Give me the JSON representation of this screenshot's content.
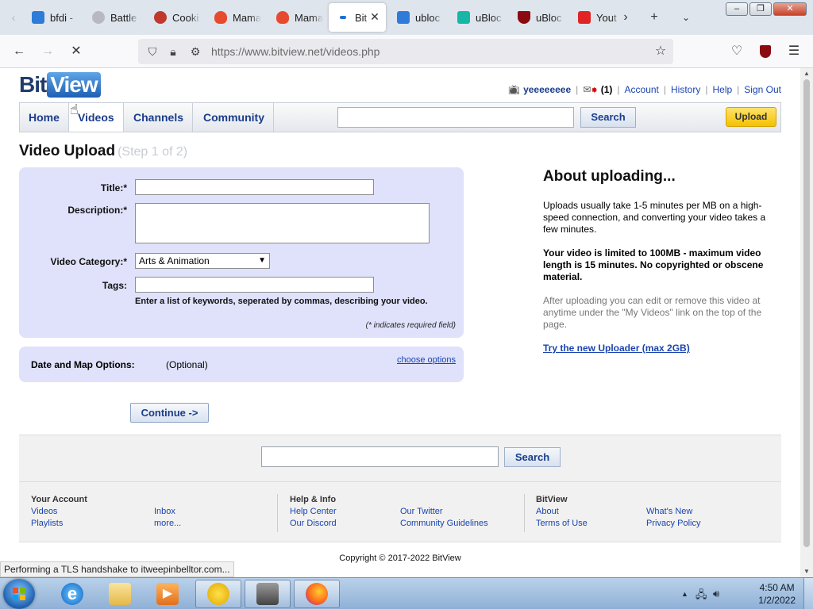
{
  "browser": {
    "tabs": [
      {
        "label": "bfdi -",
        "color": "#2f7bd9",
        "icon": "bing-icon"
      },
      {
        "label": "Battle",
        "color": "#b8b8c4",
        "icon": "gear-icon"
      },
      {
        "label": "Cooki",
        "color": "#c0392b",
        "icon": "cookie-icon"
      },
      {
        "label": "Mama",
        "color": "#e84a2f",
        "icon": "flame-icon"
      },
      {
        "label": "Mama",
        "color": "#e84a2f",
        "icon": "flame-icon"
      },
      {
        "label": "Bit",
        "color": "#1e6fd0",
        "icon": "bitview-icon",
        "active": true
      },
      {
        "label": "ubloc",
        "color": "#2f7bd9",
        "icon": "bing-icon"
      },
      {
        "label": "uBloc",
        "color": "#17b7a8",
        "icon": "puzzle-icon"
      },
      {
        "label": "uBloc",
        "color": "#8b0a12",
        "icon": "ublock-shield-icon"
      },
      {
        "label": "Yout",
        "color": "#e02424",
        "icon": "youtube-icon"
      }
    ],
    "url": "https://www.bitview.net/videos.php",
    "status_text": "Performing a TLS handshake to itweepinbelltor.com..."
  },
  "site": {
    "logo_bit": "Bit",
    "logo_view": "View",
    "user": {
      "username": "yeeeeeeee",
      "mail_count": "(1)",
      "links": [
        "Account",
        "History",
        "Help",
        "Sign Out"
      ]
    },
    "nav": {
      "tabs": [
        "Home",
        "Videos",
        "Channels",
        "Community"
      ],
      "search_button": "Search",
      "upload_button": "Upload"
    }
  },
  "upload": {
    "title": "Video Upload",
    "step": "(Step 1 of 2)",
    "fields": {
      "title_label": "Title:*",
      "description_label": "Description:*",
      "category_label": "Video Category:*",
      "category_value": "Arts & Animation",
      "tags_label": "Tags:",
      "tags_hint": "Enter a list of keywords, seperated by commas, describing your video.",
      "required_note": "(* indicates required field)"
    },
    "options": {
      "label": "Date and Map Options:",
      "value": "(Optional)",
      "link": "choose options"
    },
    "continue_button": "Continue ->"
  },
  "about": {
    "heading": "About uploading...",
    "p1": "Uploads usually take 1-5 minutes per MB on a high-speed connection, and converting your video takes a few minutes.",
    "p2": "Your video is limited to 100MB - maximum video length is 15 minutes. No copyrighted or obscene material.",
    "p3": "After uploading you can edit or remove this video at anytime under the \"My Videos\" link on the top of the page.",
    "link": "Try the new Uploader (max 2GB)"
  },
  "footer": {
    "search_button": "Search",
    "col1": {
      "heading": "Your Account",
      "links": [
        "Videos",
        "Playlists",
        "Inbox",
        "more..."
      ]
    },
    "col2": {
      "heading": "Help & Info",
      "links": [
        "Help Center",
        "Our Discord",
        "Our Twitter",
        "Community Guidelines"
      ]
    },
    "col3": {
      "heading": "BitView",
      "links": [
        "About",
        "Terms of Use",
        "What's New",
        "Privacy Policy"
      ]
    },
    "copyright": "Copyright © 2017-2022 BitView"
  },
  "taskbar": {
    "time": "4:50 AM",
    "date": "1/2/2022"
  }
}
